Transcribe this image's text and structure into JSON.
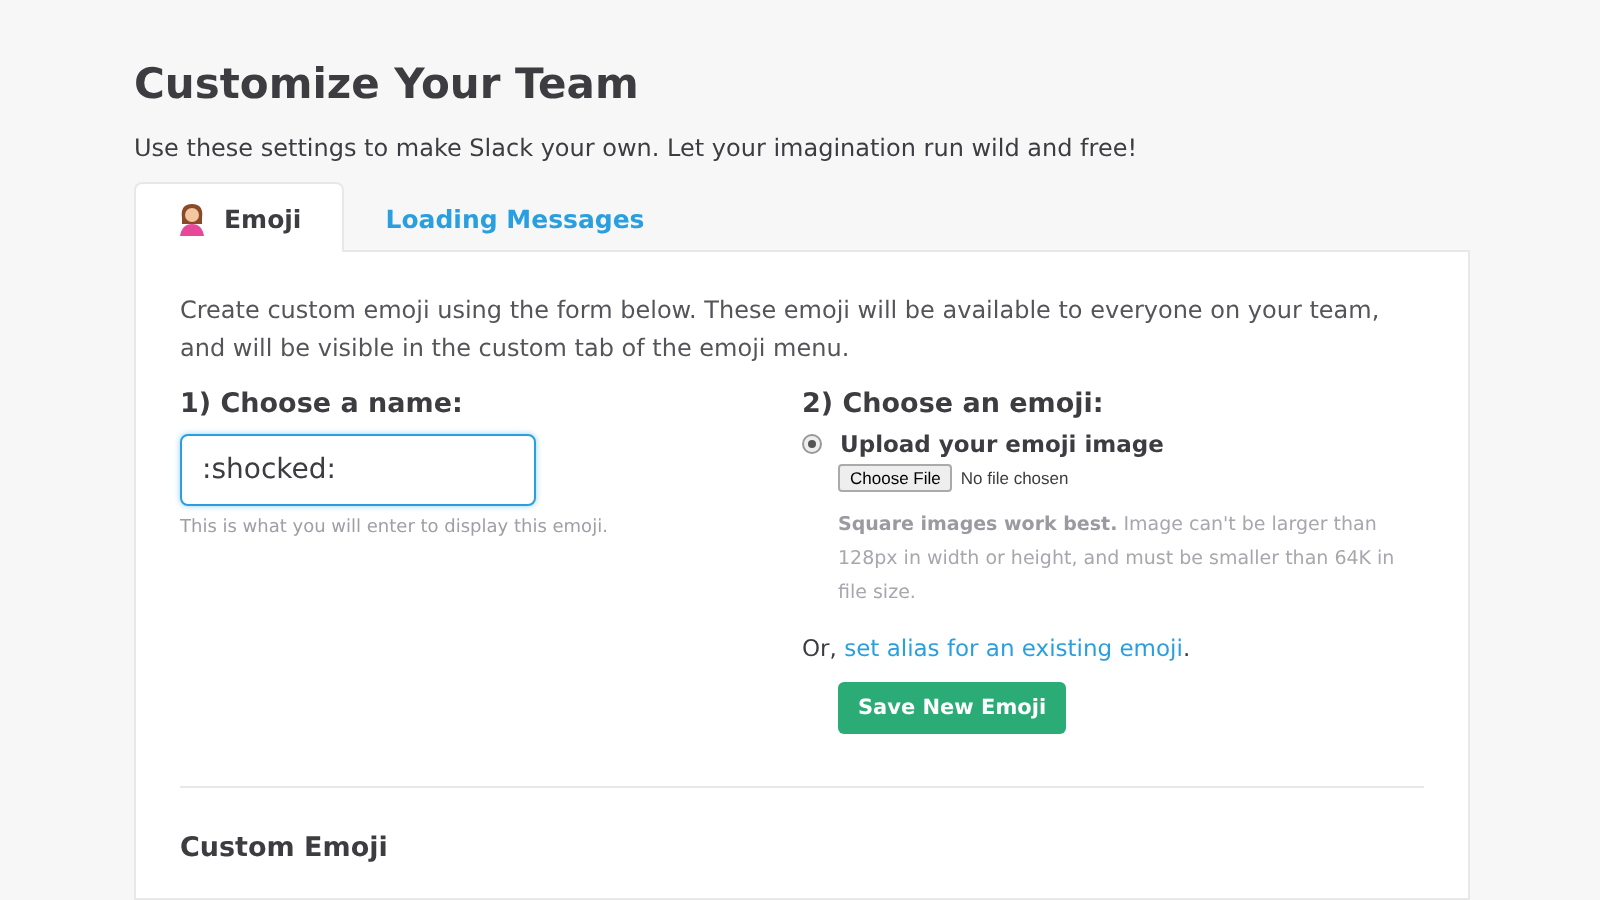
{
  "page": {
    "title": "Customize Your Team",
    "subtitle": "Use these settings to make Slack your own. Let your imagination run wild and free!"
  },
  "tabs": [
    {
      "label": "Emoji",
      "selected": true,
      "kind": "emoji"
    },
    {
      "label": "Loading Messages",
      "selected": false,
      "kind": "plain"
    }
  ],
  "intro": "Create custom emoji using the form below. These emoji will be available to everyone on your team, and will be visible in the custom tab of the emoji menu.",
  "name_section": {
    "heading": "1) Choose a name:",
    "value": ":shocked:",
    "hint": "This is what you will enter to display this emoji."
  },
  "emoji_section": {
    "heading": "2) Choose an emoji:",
    "option": {
      "label": "Upload your emoji image",
      "selected": true
    },
    "file_button": "Choose File",
    "file_status": "No file chosen",
    "note": "**Square images work best.** Image can't be larger than 128px in width or height, and must be smaller than 64K in file size.",
    "alias_prefix": "Or, ",
    "alias_link": "set alias for an existing emoji",
    "alias_suffix": ".",
    "save_button": "Save New Emoji"
  },
  "custom_heading": "Custom Emoji"
}
